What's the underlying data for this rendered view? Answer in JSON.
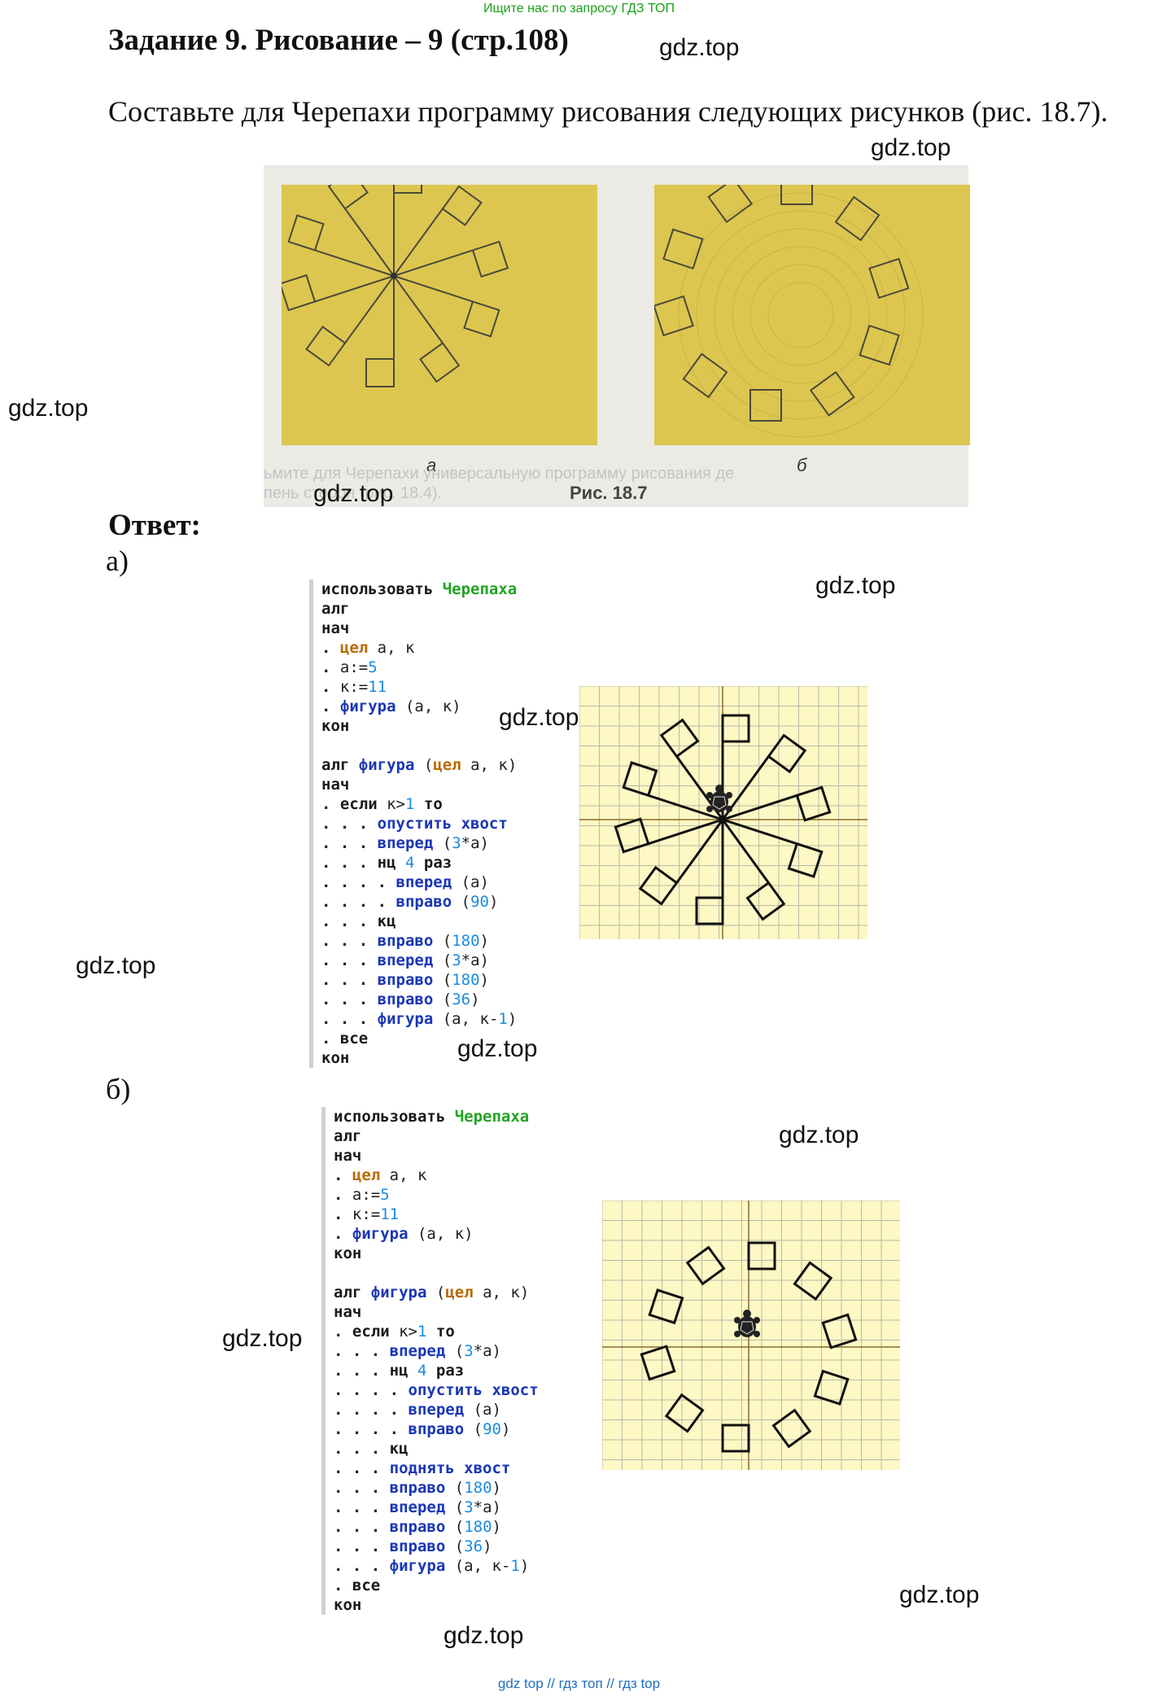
{
  "header_link": "Ищите нас по запросу ГДЗ ТОП",
  "title": "Задание 9. Рисование – 9 (стр.108)",
  "task_text": "Составьте для Черепахи программу рисования следующих рисунков (рис. 18.7).",
  "figure": {
    "label_a": "а",
    "label_b": "б",
    "caption": "Рис. 18.7",
    "bleed_line1": "ьмите для Черепахи универсальную программу рисования де",
    "bleed_line2": "пень сторон (рис. 18.4)."
  },
  "answer_label": "Ответ:",
  "part_a": "а)",
  "part_b": "б)",
  "watermark": "gdz.top",
  "footer_links": "gdz top  //  гдз топ  //  гдз top",
  "code_a": [
    [
      [
        "k",
        "использовать "
      ],
      [
        "g",
        "Черепаха"
      ]
    ],
    [
      [
        "k",
        "алг"
      ]
    ],
    [
      [
        "k",
        "нач"
      ]
    ],
    [
      [
        "d",
        "."
      ],
      [
        "c",
        " "
      ],
      [
        "ty",
        "цел"
      ],
      [
        "c",
        " а, к"
      ]
    ],
    [
      [
        "d",
        "."
      ],
      [
        "c",
        " а:="
      ],
      [
        "n",
        "5"
      ]
    ],
    [
      [
        "d",
        "."
      ],
      [
        "c",
        " к:="
      ],
      [
        "n",
        "11"
      ]
    ],
    [
      [
        "d",
        "."
      ],
      [
        "c",
        " "
      ],
      [
        "f",
        "фигура"
      ],
      [
        "c",
        " (а, к)"
      ]
    ],
    [
      [
        "k",
        "кон"
      ]
    ],
    [],
    [
      [
        "k",
        "алг "
      ],
      [
        "f",
        "фигура"
      ],
      [
        "c",
        " ("
      ],
      [
        "ty",
        "цел"
      ],
      [
        "c",
        " а, к)"
      ]
    ],
    [
      [
        "k",
        "нач"
      ]
    ],
    [
      [
        "d",
        "."
      ],
      [
        "c",
        " "
      ],
      [
        "k",
        "если"
      ],
      [
        "c",
        " к>"
      ],
      [
        "n",
        "1"
      ],
      [
        "c",
        " "
      ],
      [
        "k",
        "то"
      ]
    ],
    [
      [
        "d",
        ". . ."
      ],
      [
        "c",
        " "
      ],
      [
        "f",
        "опустить хвост"
      ]
    ],
    [
      [
        "d",
        ". . ."
      ],
      [
        "c",
        " "
      ],
      [
        "f",
        "вперед"
      ],
      [
        "c",
        " ("
      ],
      [
        "n",
        "3"
      ],
      [
        "c",
        "*а)"
      ]
    ],
    [
      [
        "d",
        ". . ."
      ],
      [
        "c",
        " "
      ],
      [
        "k",
        "нц"
      ],
      [
        "c",
        " "
      ],
      [
        "n",
        "4"
      ],
      [
        "c",
        " "
      ],
      [
        "k",
        "раз"
      ]
    ],
    [
      [
        "d",
        ". . . ."
      ],
      [
        "c",
        " "
      ],
      [
        "f",
        "вперед"
      ],
      [
        "c",
        " (а)"
      ]
    ],
    [
      [
        "d",
        ". . . ."
      ],
      [
        "c",
        " "
      ],
      [
        "f",
        "вправо"
      ],
      [
        "c",
        " ("
      ],
      [
        "n",
        "90"
      ],
      [
        "c",
        ")"
      ]
    ],
    [
      [
        "d",
        ". . ."
      ],
      [
        "c",
        " "
      ],
      [
        "k",
        "кц"
      ]
    ],
    [
      [
        "d",
        ". . ."
      ],
      [
        "c",
        " "
      ],
      [
        "f",
        "вправо"
      ],
      [
        "c",
        " ("
      ],
      [
        "n",
        "180"
      ],
      [
        "c",
        ")"
      ]
    ],
    [
      [
        "d",
        ". . ."
      ],
      [
        "c",
        " "
      ],
      [
        "f",
        "вперед"
      ],
      [
        "c",
        " ("
      ],
      [
        "n",
        "3"
      ],
      [
        "c",
        "*а)"
      ]
    ],
    [
      [
        "d",
        ". . ."
      ],
      [
        "c",
        " "
      ],
      [
        "f",
        "вправо"
      ],
      [
        "c",
        " ("
      ],
      [
        "n",
        "180"
      ],
      [
        "c",
        ")"
      ]
    ],
    [
      [
        "d",
        ". . ."
      ],
      [
        "c",
        " "
      ],
      [
        "f",
        "вправо"
      ],
      [
        "c",
        " ("
      ],
      [
        "n",
        "36"
      ],
      [
        "c",
        ")"
      ]
    ],
    [
      [
        "d",
        ". . ."
      ],
      [
        "c",
        " "
      ],
      [
        "f",
        "фигура"
      ],
      [
        "c",
        " (а, к-"
      ],
      [
        "n",
        "1"
      ],
      [
        "c",
        ")"
      ]
    ],
    [
      [
        "d",
        "."
      ],
      [
        "c",
        " "
      ],
      [
        "k",
        "все"
      ]
    ],
    [
      [
        "k",
        "кон"
      ]
    ]
  ],
  "code_b": [
    [
      [
        "k",
        "использовать "
      ],
      [
        "g",
        "Черепаха"
      ]
    ],
    [
      [
        "k",
        "алг"
      ]
    ],
    [
      [
        "k",
        "нач"
      ]
    ],
    [
      [
        "d",
        "."
      ],
      [
        "c",
        " "
      ],
      [
        "ty",
        "цел"
      ],
      [
        "c",
        " а, к"
      ]
    ],
    [
      [
        "d",
        "."
      ],
      [
        "c",
        " а:="
      ],
      [
        "n",
        "5"
      ]
    ],
    [
      [
        "d",
        "."
      ],
      [
        "c",
        " к:="
      ],
      [
        "n",
        "11"
      ]
    ],
    [
      [
        "d",
        "."
      ],
      [
        "c",
        " "
      ],
      [
        "f",
        "фигура"
      ],
      [
        "c",
        " (а, к)"
      ]
    ],
    [
      [
        "k",
        "кон"
      ]
    ],
    [],
    [
      [
        "k",
        "алг "
      ],
      [
        "f",
        "фигура"
      ],
      [
        "c",
        " ("
      ],
      [
        "ty",
        "цел"
      ],
      [
        "c",
        " а, к)"
      ]
    ],
    [
      [
        "k",
        "нач"
      ]
    ],
    [
      [
        "d",
        "."
      ],
      [
        "c",
        " "
      ],
      [
        "k",
        "если"
      ],
      [
        "c",
        " к>"
      ],
      [
        "n",
        "1"
      ],
      [
        "c",
        " "
      ],
      [
        "k",
        "то"
      ]
    ],
    [
      [
        "d",
        ". . ."
      ],
      [
        "c",
        " "
      ],
      [
        "f",
        "вперед"
      ],
      [
        "c",
        " ("
      ],
      [
        "n",
        "3"
      ],
      [
        "c",
        "*а)"
      ]
    ],
    [
      [
        "d",
        ". . ."
      ],
      [
        "c",
        " "
      ],
      [
        "k",
        "нц"
      ],
      [
        "c",
        " "
      ],
      [
        "n",
        "4"
      ],
      [
        "c",
        " "
      ],
      [
        "k",
        "раз"
      ]
    ],
    [
      [
        "d",
        ". . . ."
      ],
      [
        "c",
        " "
      ],
      [
        "f",
        "опустить хвост"
      ]
    ],
    [
      [
        "d",
        ". . . ."
      ],
      [
        "c",
        " "
      ],
      [
        "f",
        "вперед"
      ],
      [
        "c",
        " (а)"
      ]
    ],
    [
      [
        "d",
        ". . . ."
      ],
      [
        "c",
        " "
      ],
      [
        "f",
        "вправо"
      ],
      [
        "c",
        " ("
      ],
      [
        "n",
        "90"
      ],
      [
        "c",
        ")"
      ]
    ],
    [
      [
        "d",
        ". . ."
      ],
      [
        "c",
        " "
      ],
      [
        "k",
        "кц"
      ]
    ],
    [
      [
        "d",
        ". . ."
      ],
      [
        "c",
        " "
      ],
      [
        "f",
        "поднять хвост"
      ]
    ],
    [
      [
        "d",
        ". . ."
      ],
      [
        "c",
        " "
      ],
      [
        "f",
        "вправо"
      ],
      [
        "c",
        " ("
      ],
      [
        "n",
        "180"
      ],
      [
        "c",
        ")"
      ]
    ],
    [
      [
        "d",
        ". . ."
      ],
      [
        "c",
        " "
      ],
      [
        "f",
        "вперед"
      ],
      [
        "c",
        " ("
      ],
      [
        "n",
        "3"
      ],
      [
        "c",
        "*а)"
      ]
    ],
    [
      [
        "d",
        ". . ."
      ],
      [
        "c",
        " "
      ],
      [
        "f",
        "вправо"
      ],
      [
        "c",
        " ("
      ],
      [
        "n",
        "180"
      ],
      [
        "c",
        ")"
      ]
    ],
    [
      [
        "d",
        ". . ."
      ],
      [
        "c",
        " "
      ],
      [
        "f",
        "вправо"
      ],
      [
        "c",
        " ("
      ],
      [
        "n",
        "36"
      ],
      [
        "c",
        ")"
      ]
    ],
    [
      [
        "d",
        ". . ."
      ],
      [
        "c",
        " "
      ],
      [
        "f",
        "фигура"
      ],
      [
        "c",
        " (а, к-"
      ],
      [
        "n",
        "1"
      ],
      [
        "c",
        ")"
      ]
    ],
    [
      [
        "d",
        "."
      ],
      [
        "c",
        " "
      ],
      [
        "k",
        "все"
      ]
    ],
    [
      [
        "k",
        "кон"
      ]
    ]
  ]
}
